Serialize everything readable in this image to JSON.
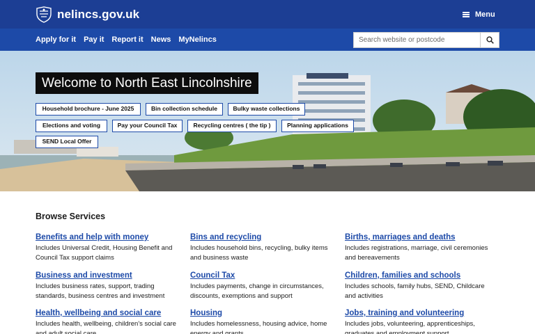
{
  "header": {
    "site_name": "nelincs.gov.uk",
    "menu_label": "Menu"
  },
  "nav": {
    "links": [
      "Apply for it",
      "Pay it",
      "Report it",
      "News",
      "MyNelincs"
    ]
  },
  "search": {
    "placeholder": "Search website or postcode",
    "icon": "search-icon"
  },
  "hero": {
    "title": "Welcome to North East Lincolnshire",
    "quick_links": [
      "Household brochure - June 2025",
      "Bin collection schedule",
      "Bulky waste collections",
      "Elections and voting",
      "Pay your Council Tax",
      "Recycling centres ( the tip )",
      "Planning applications",
      "SEND Local Offer"
    ]
  },
  "services": {
    "heading": "Browse Services",
    "items": [
      {
        "title": "Benefits and help with money",
        "desc": "Includes Universal Credit, Housing Benefit and Council Tax support claims"
      },
      {
        "title": "Bins and recycling",
        "desc": "Includes household bins, recycling, bulky items and business waste"
      },
      {
        "title": "Births, marriages and deaths",
        "desc": "Includes registrations, marriage, civil ceremonies and bereavements"
      },
      {
        "title": "Business and investment",
        "desc": "Includes business rates, support, trading standards, business centres and investment"
      },
      {
        "title": "Council Tax",
        "desc": "Includes payments, change in circumstances, discounts, exemptions and support"
      },
      {
        "title": "Children, families and schools",
        "desc": "Includes schools, family hubs, SEND, Childcare and activities"
      },
      {
        "title": "Health, wellbeing and social care",
        "desc": "Includes health, wellbeing, children's social care and adult social care"
      },
      {
        "title": "Housing",
        "desc": "Includes homelessness, housing advice, home energy and grants"
      },
      {
        "title": "Jobs, training and volunteering",
        "desc": "Includes jobs, volunteering, apprenticeships, graduates and employment support"
      }
    ]
  },
  "colors": {
    "header_bg": "#1c3e94",
    "nav_bg": "#1d4aa8",
    "link": "#1d4aa8",
    "welcome_bg": "#0d0d0d"
  }
}
